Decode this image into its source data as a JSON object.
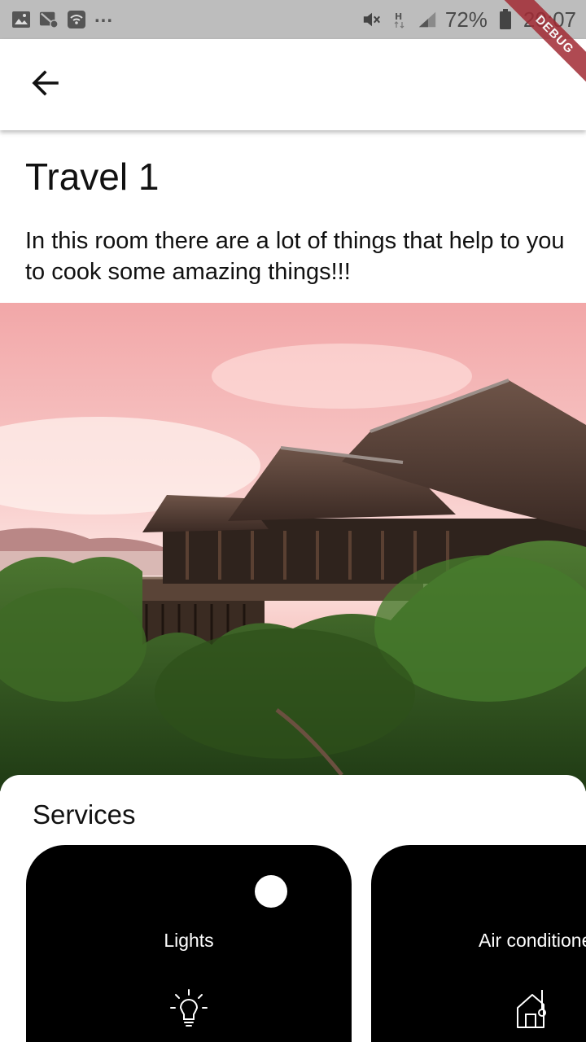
{
  "status_bar": {
    "battery_percent": "72%",
    "time": "20:07",
    "overflow": "..."
  },
  "debug_banner": "DEBUG",
  "header": {
    "title": "Travel 1",
    "description": "In this room there are a lot of things that help to you to cook some amazing things!!!"
  },
  "services": {
    "title": "Services",
    "cards": [
      {
        "label": "Lights",
        "icon": "lightbulb-icon",
        "toggle_on": true
      },
      {
        "label": "Air conditioner",
        "icon": "thermometer-home-icon"
      }
    ]
  },
  "colors": {
    "card_background": "#000000",
    "status_bar": "#bdbdbd",
    "debug_ribbon": "#a22b34"
  }
}
